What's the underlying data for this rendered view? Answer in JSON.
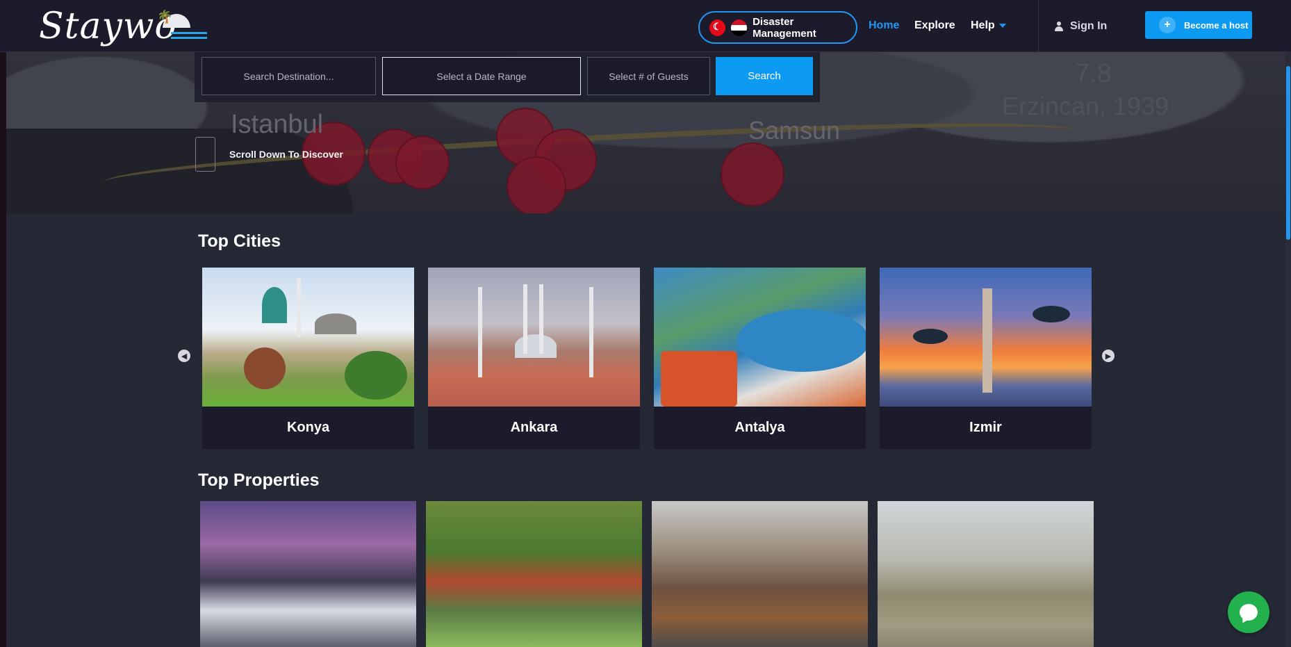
{
  "header": {
    "logo_text": "Staywo",
    "disaster_label": "Disaster Management",
    "nav": {
      "home": "Home",
      "explore": "Explore",
      "help": "Help"
    },
    "sign_in": "Sign In",
    "become_host": "Become a host",
    "become_host_icon": "+"
  },
  "hero": {
    "map_labels": {
      "city_west": "Istanbul",
      "city_east": "Samsun",
      "magnitude": "7.8",
      "event": "Erzincan, 1939"
    },
    "search": {
      "destination_placeholder": "Search Destination...",
      "date_placeholder": "Select a Date Range",
      "guests_placeholder": "Select # of Guests",
      "button": "Search"
    },
    "scroll_hint": "Scroll Down To Discover"
  },
  "top_cities": {
    "title": "Top Cities",
    "cities": [
      {
        "name": "Konya"
      },
      {
        "name": "Ankara"
      },
      {
        "name": "Antalya"
      },
      {
        "name": "Izmir"
      }
    ]
  },
  "top_properties": {
    "title": "Top Properties"
  },
  "colors": {
    "accent": "#0d9af2",
    "nav_active": "#2196f3",
    "header_bg": "#1c1b2b",
    "page_bg": "#252935",
    "chat_green": "#22b14c"
  },
  "icons": {
    "prev": "chevron-left-icon",
    "next": "chevron-right-icon",
    "user": "user-icon",
    "chat": "chat-icon"
  }
}
